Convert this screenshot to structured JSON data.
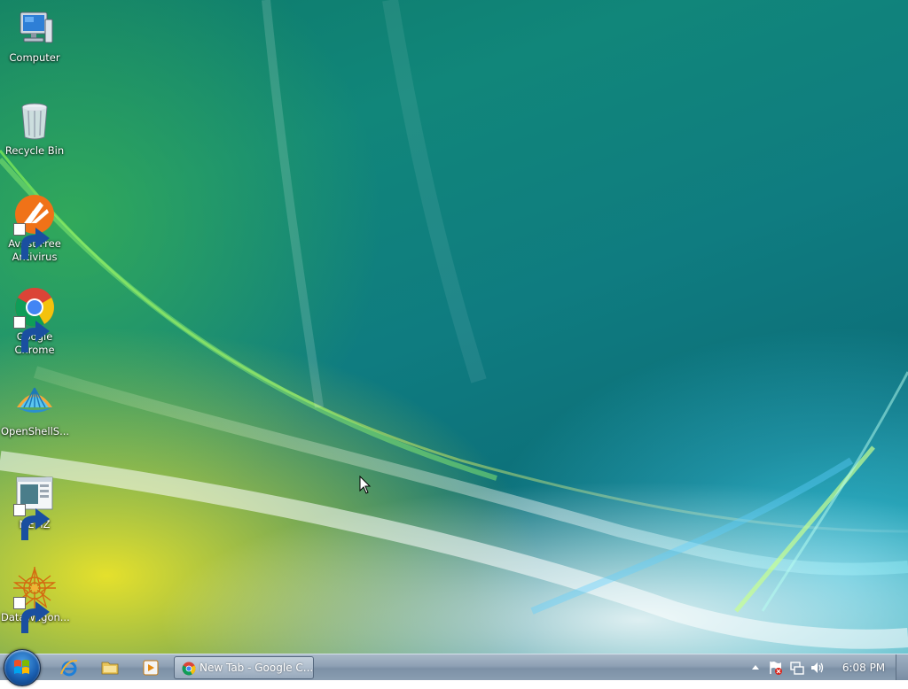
{
  "desktop": {
    "icons": [
      {
        "label": "Computer",
        "icon": "computer-icon",
        "shortcut": false
      },
      {
        "label": "Recycle Bin",
        "icon": "recycle-bin-icon",
        "shortcut": false
      },
      {
        "label": "Avast Free Antivirus",
        "icon": "avast-icon",
        "shortcut": true
      },
      {
        "label": "Google Chrome",
        "icon": "chrome-icon",
        "shortcut": true
      },
      {
        "label": "OpenShellS...",
        "icon": "openshell-icon",
        "shortcut": false
      },
      {
        "label": "MEMZ",
        "icon": "memz-icon",
        "shortcut": true
      },
      {
        "label": "DataWagon...",
        "icon": "datawagon-icon",
        "shortcut": true
      }
    ]
  },
  "taskbar": {
    "start_button": "windows-start-icon",
    "quick_launch": [
      "internet-explorer-icon",
      "windows-explorer-icon",
      "media-player-icon"
    ],
    "tasks": [
      {
        "label": "New Tab - Google C...",
        "icon": "chrome-icon",
        "active": true
      }
    ],
    "tray": {
      "show_hidden_icon": "up-arrow-icon",
      "icons": [
        "action-center-flag-icon",
        "network-icon",
        "volume-icon"
      ]
    },
    "clock": "6:08 PM"
  },
  "colors": {
    "taskbar": "#8ea0b4",
    "desktop_teal": "#0f7c80",
    "desktop_yellow": "#f0e628"
  }
}
